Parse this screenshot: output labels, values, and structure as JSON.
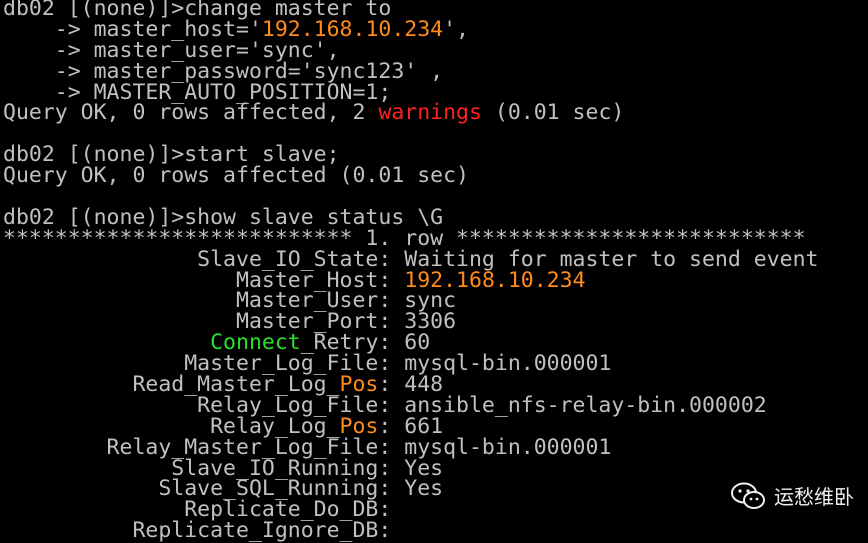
{
  "terminal": {
    "lines": [
      [
        {
          "t": "db02 [(none)]>change master to"
        }
      ],
      [
        {
          "t": "    -> master_host='"
        },
        {
          "t": "192.168.10.234",
          "c": "orange"
        },
        {
          "t": "',"
        }
      ],
      [
        {
          "t": "    -> master_user='sync',"
        }
      ],
      [
        {
          "t": "    -> master_password='sync123' ,"
        }
      ],
      [
        {
          "t": "    -> MASTER_AUTO_POSITION=1;"
        }
      ],
      [
        {
          "t": "Query OK, 0 rows affected, 2 "
        },
        {
          "t": "warnings",
          "c": "red"
        },
        {
          "t": " (0.01 sec)"
        }
      ],
      [
        {
          "t": ""
        }
      ],
      [
        {
          "t": "db02 [(none)]>start slave;"
        }
      ],
      [
        {
          "t": "Query OK, 0 rows affected (0.01 sec)"
        }
      ],
      [
        {
          "t": ""
        }
      ],
      [
        {
          "t": "db02 [(none)]>show slave status \\G"
        }
      ],
      [
        {
          "t": "*************************** 1. row ***************************"
        }
      ],
      [
        {
          "t": "               Slave_IO_State: Waiting for master to send event"
        }
      ],
      [
        {
          "t": "                  Master_Host: "
        },
        {
          "t": "192.168.10.234",
          "c": "orange"
        }
      ],
      [
        {
          "t": "                  Master_User: sync"
        }
      ],
      [
        {
          "t": "                  Master_Port: 3306"
        }
      ],
      [
        {
          "t": "                "
        },
        {
          "t": "Connect",
          "c": "green"
        },
        {
          "t": "_Retry: 60"
        }
      ],
      [
        {
          "t": "              Master_Log_File: mysql-bin.000001"
        }
      ],
      [
        {
          "t": "          Read_Master_Log_"
        },
        {
          "t": "Pos",
          "c": "orange"
        },
        {
          "t": ": 448"
        }
      ],
      [
        {
          "t": "               Relay_Log_File: ansible_nfs-relay-bin.000002"
        }
      ],
      [
        {
          "t": "                Relay_Log_"
        },
        {
          "t": "Pos",
          "c": "orange"
        },
        {
          "t": ": 661"
        }
      ],
      [
        {
          "t": "        Relay_Master_Log_File: mysql-bin.000001"
        }
      ],
      [
        {
          "t": "             Slave_IO_Running: Yes"
        }
      ],
      [
        {
          "t": "            Slave_SQL_Running: Yes"
        }
      ],
      [
        {
          "t": "              Replicate_Do_DB:"
        }
      ],
      [
        {
          "t": "          Replicate_Ignore_DB:"
        }
      ]
    ]
  },
  "watermark": {
    "icon": "wechat-icon",
    "text": "运愁维卧"
  },
  "colors": {
    "background": "#000000",
    "text": "#c0c0c0",
    "orange": "#ff8c1a",
    "red": "#ff2020",
    "green": "#28e028"
  }
}
